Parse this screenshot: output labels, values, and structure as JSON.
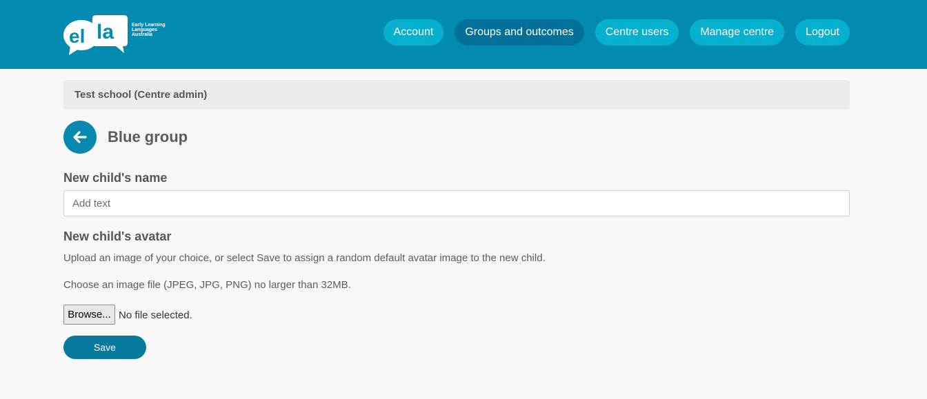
{
  "header": {
    "logo": {
      "mark": "ella",
      "tagline_lines": [
        "Early Learning",
        "Languages",
        "Australia"
      ]
    },
    "nav": [
      {
        "label": "Account",
        "active": false
      },
      {
        "label": "Groups and outcomes",
        "active": true
      },
      {
        "label": "Centre users",
        "active": false
      },
      {
        "label": "Manage centre",
        "active": false
      },
      {
        "label": "Logout",
        "active": false
      }
    ]
  },
  "breadcrumb": "Test school (Centre admin)",
  "page": {
    "back_icon": "arrow-left-icon",
    "title": "Blue group"
  },
  "form": {
    "name_label": "New child's name",
    "name_value": "",
    "name_placeholder": "Add text",
    "avatar_label": "New child's avatar",
    "avatar_help": "Upload an image of your choice, or select Save to assign a random default avatar image to the new child.",
    "file_help": "Choose an image file (JPEG, JPG, PNG) no larger than 32MB.",
    "browse_label": "Browse...",
    "file_status": "No file selected.",
    "save_label": "Save"
  },
  "colors": {
    "header_bg": "#038ab0",
    "nav_button": "#06b0cf",
    "nav_active": "#03709a",
    "accent": "#057a9c"
  }
}
